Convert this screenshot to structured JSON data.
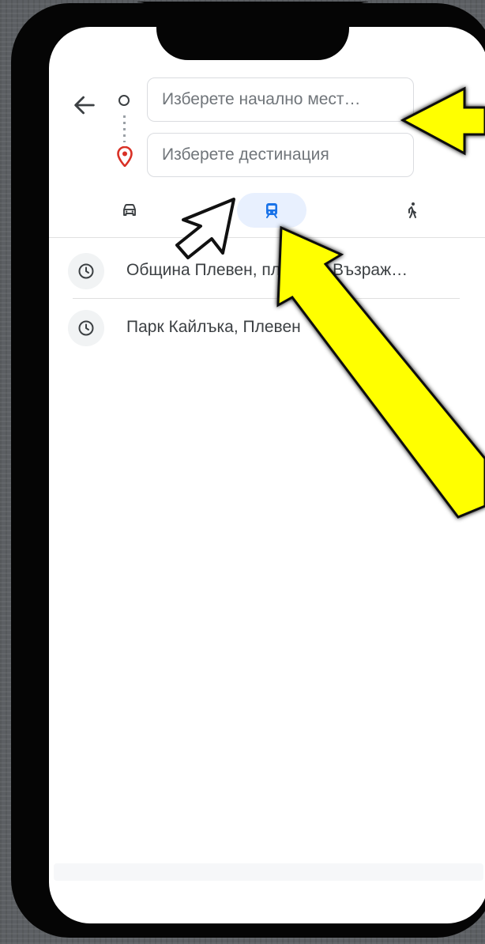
{
  "directions": {
    "start_placeholder": "Изберете начално мест…",
    "destination_placeholder": "Изберете дестинация"
  },
  "modes": [
    {
      "name": "car",
      "icon": "car-icon"
    },
    {
      "name": "transit",
      "icon": "transit-icon",
      "selected": true
    },
    {
      "name": "walk",
      "icon": "walk-icon"
    }
  ],
  "recent": [
    {
      "label": "Община Плевен, площад „Възраж…",
      "icon": "clock-icon"
    },
    {
      "label": "Парк Кайлъка, Плевен",
      "icon": "clock-icon"
    }
  ],
  "colors": {
    "annotation_arrow": "#ffff00",
    "transit_selected_bg": "#e8f0fe",
    "transit_icon": "#1a73e8",
    "pin": "#d93025"
  }
}
